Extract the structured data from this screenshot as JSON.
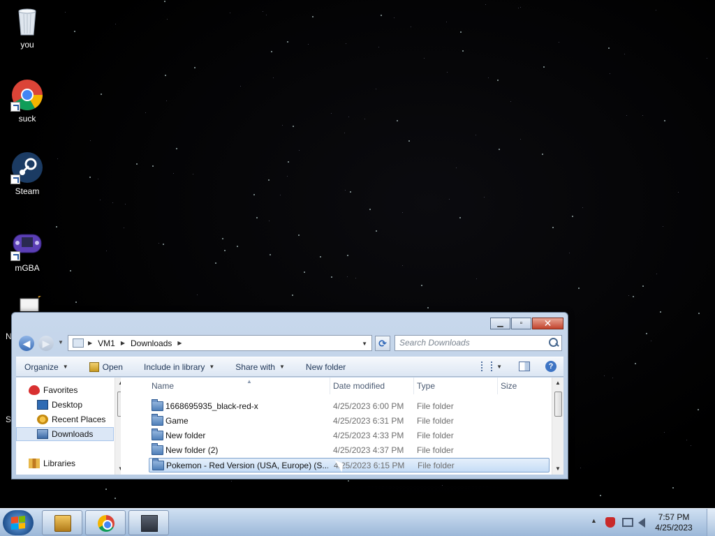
{
  "desktop": {
    "icons": [
      {
        "label": "you",
        "icon": "recycle-bin-icon"
      },
      {
        "label": "suck",
        "icon": "chrome-icon"
      },
      {
        "label": "Steam",
        "icon": "steam-icon"
      },
      {
        "label": "mGBA",
        "icon": "mgba-icon"
      },
      {
        "label": "N",
        "icon": "notepad-icon"
      },
      {
        "label": "Sl",
        "icon": "shortcut-icon"
      }
    ]
  },
  "explorer": {
    "breadcrumb": [
      "VM1",
      "Downloads"
    ],
    "search_placeholder": "Search Downloads",
    "toolbar": {
      "organize": "Organize",
      "open": "Open",
      "include_in_library": "Include in library",
      "share_with": "Share with",
      "new_folder": "New folder"
    },
    "nav_pane": {
      "favorites": "Favorites",
      "desktop": "Desktop",
      "recent_places": "Recent Places",
      "downloads": "Downloads",
      "libraries": "Libraries"
    },
    "columns": {
      "name": "Name",
      "date_modified": "Date modified",
      "type": "Type",
      "size": "Size"
    },
    "files": [
      {
        "name": "1668695935_black-red-x",
        "date": "4/25/2023 6:00 PM",
        "type": "File folder"
      },
      {
        "name": "Game",
        "date": "4/25/2023 6:31 PM",
        "type": "File folder"
      },
      {
        "name": "New folder",
        "date": "4/25/2023 4:33 PM",
        "type": "File folder"
      },
      {
        "name": "New folder (2)",
        "date": "4/25/2023 4:37 PM",
        "type": "File folder"
      },
      {
        "name": "Pokemon - Red Version (USA, Europe) (S...",
        "date": "4/25/2023 6:15 PM",
        "type": "File folder"
      }
    ],
    "selected_index": 4
  },
  "taskbar": {
    "apps": [
      "windows-explorer-icon",
      "chrome-icon",
      "remote-desktop-icon"
    ],
    "clock_time": "7:57 PM",
    "clock_date": "4/25/2023"
  },
  "colors": {
    "selection": "#c5dcf6",
    "close_button": "#c2432c",
    "taskbar": "#9bb7d8"
  }
}
